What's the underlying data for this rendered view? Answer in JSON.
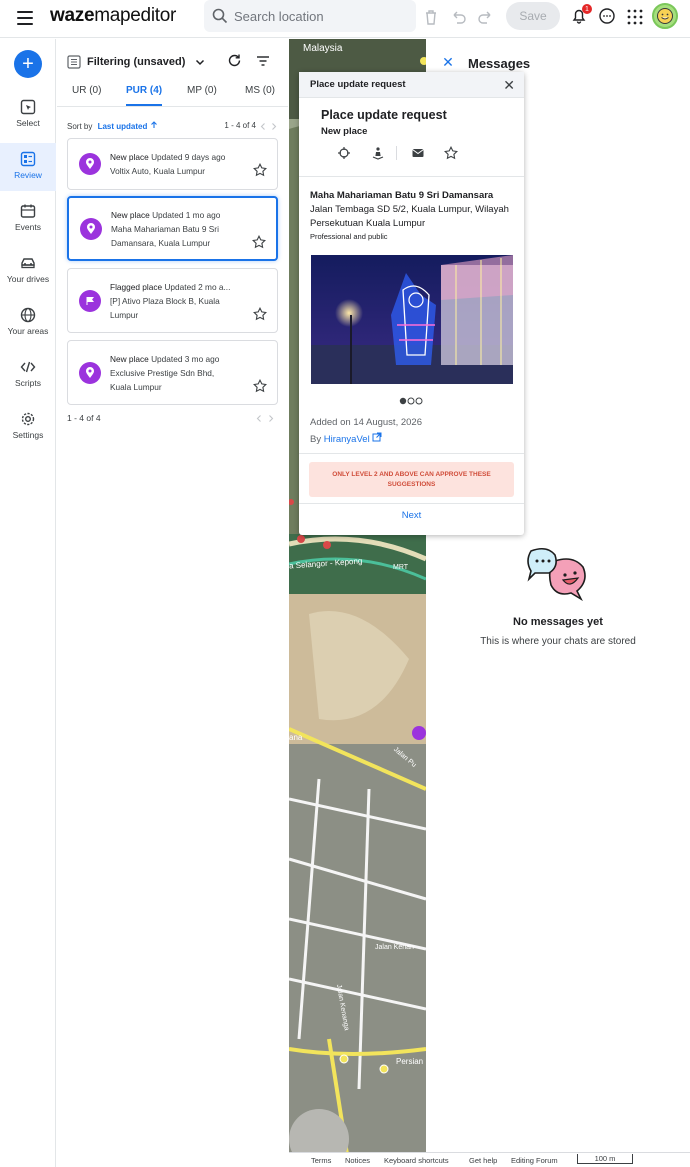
{
  "app": {
    "logo_bold": "waze",
    "logo_light": "mapeditor"
  },
  "header": {
    "search_placeholder": "Search location",
    "save_label": "Save",
    "notification_count": "1"
  },
  "rail": [
    {
      "label": "Select",
      "icon": "select-icon"
    },
    {
      "label": "Review",
      "icon": "review-icon",
      "active": true
    },
    {
      "label": "Events",
      "icon": "events-icon"
    },
    {
      "label": "Your drives",
      "icon": "car-icon"
    },
    {
      "label": "Your areas",
      "icon": "globe-icon"
    },
    {
      "label": "Scripts",
      "icon": "code-icon"
    },
    {
      "label": "Settings",
      "icon": "gear-icon"
    }
  ],
  "panel": {
    "filter_label": "Filtering (unsaved)",
    "tabs": [
      {
        "label": "UR (0)"
      },
      {
        "label": "PUR (4)",
        "active": true
      },
      {
        "label": "MP (0)"
      },
      {
        "label": "MS (0)"
      }
    ],
    "sort_label": "Sort by",
    "sort_value": "Last updated",
    "count_top": "1 - 4 of 4",
    "count_bottom": "1 - 4 of 4",
    "items": [
      {
        "type": "New place",
        "updated": "Updated 9 days ago",
        "line2": "Voltix Auto, Kuala Lumpur",
        "line3": ""
      },
      {
        "type": "New place",
        "updated": "Updated 1 mo ago",
        "line2": "Maha Mahariaman Batu 9 Sri",
        "line3": "Damansara, Kuala Lumpur",
        "selected": true
      },
      {
        "type": "Flagged place",
        "updated": "Updated 2 mo a...",
        "line2": "[P] Ativo Plaza Block B, Kuala",
        "line3": "Lumpur"
      },
      {
        "type": "New place",
        "updated": "Updated 3 mo ago",
        "line2": "Exclusive Prestige Sdn Bhd,",
        "line3": "Kuala Lumpur"
      }
    ]
  },
  "map": {
    "labels": [
      "Malaysia",
      "a Selangor - Kepong",
      "MRT",
      "ana",
      "Jalan Pu",
      "Jalan Kenan",
      "Jalan Kenanga",
      "Persian"
    ],
    "footer": [
      "Terms",
      "Notices",
      "Keyboard shortcuts",
      "Get help",
      "Editing Forum",
      "100 m"
    ]
  },
  "popup": {
    "header": "Place update request",
    "title": "Place update request",
    "subtitle": "New place",
    "place_name": "Maha Mahariaman Batu 9 Sri Damansara",
    "address": "Jalan Tembaga SD 5/2, Kuala Lumpur, Wilayah Persekutuan Kuala Lumpur",
    "category": "Professional and public",
    "added": "Added on 14 August, 2026",
    "by_label": "By",
    "by_user": "HiranyaVel",
    "warning": "ONLY LEVEL 2 AND ABOVE CAN APPROVE THESE SUGGESTIONS",
    "next_label": "Next"
  },
  "messages": {
    "title": "Messages",
    "empty_title": "No messages yet",
    "empty_sub": "This is where your chats are stored"
  },
  "colors": {
    "accent": "#1a73e8",
    "pin": "#9b33dd",
    "warning_bg": "#fde3de",
    "warning_text": "#d04d3a"
  }
}
